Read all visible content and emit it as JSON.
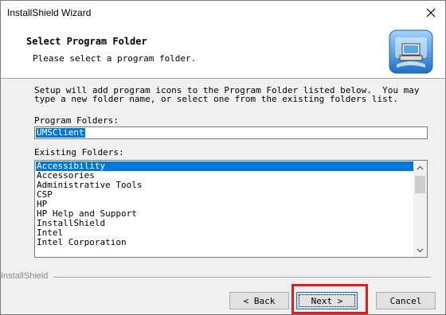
{
  "window": {
    "title": "InstallShield Wizard",
    "close_glyph": "×"
  },
  "header": {
    "title": "Select Program Folder",
    "subtitle": "Please select a program folder.",
    "icon": "installer-computer-icon"
  },
  "instructions": "Setup will add program icons to the Program Folder listed below.  You may\ntype a new folder name, or select one from the existing folders list.",
  "program_folders": {
    "label": "Program Folders:",
    "value": "UMSClient"
  },
  "existing_folders": {
    "label": "Existing Folders:",
    "items": [
      "Accessibility",
      "Accessories",
      "Administrative Tools",
      "CSP",
      "HP",
      "HP Help and Support",
      "InstallShield",
      "Intel",
      "Intel Corporation"
    ],
    "selected_index": 0
  },
  "footer": {
    "brand": "InstallShield"
  },
  "buttons": {
    "back": "< Back",
    "next": "Next >",
    "cancel": "Cancel"
  },
  "colors": {
    "selection": "#0078d7",
    "highlight_box": "#e21b1b"
  }
}
